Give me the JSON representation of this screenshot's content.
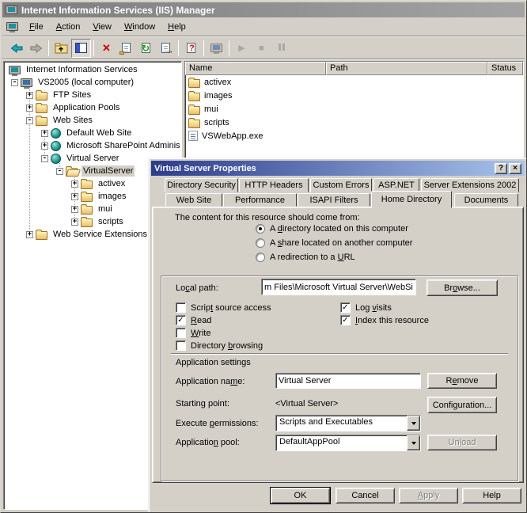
{
  "colors": {
    "face": "#d4d0c8",
    "titlebar_inactive_from": "#7d7d7d",
    "titlebar_inactive_to": "#a3a3a3",
    "dialog_titlebar_from": "#2c3c8c",
    "dialog_titlebar_to": "#a8c4ec",
    "delete_red": "#c40000",
    "selection_inactive": "#d4d0c8"
  },
  "window": {
    "title": "Internet Information Services (IIS) Manager"
  },
  "menu": {
    "items": [
      {
        "key": "F",
        "post": "ile"
      },
      {
        "key": "A",
        "post": "ction"
      },
      {
        "key": "V",
        "post": "iew"
      },
      {
        "key": "W",
        "post": "indow"
      },
      {
        "key": "H",
        "post": "elp"
      }
    ]
  },
  "toolbar": {
    "glyphs": {
      "delete": "✕",
      "refresh": "↻",
      "export_arrow": "→",
      "help": "?",
      "play": "▶",
      "stop": "■"
    }
  },
  "tree": {
    "items": [
      {
        "label": "Internet Information Services",
        "exp": "",
        "icon": "iis-server"
      },
      {
        "label": "VS2005 (local computer)",
        "exp": "-",
        "icon": "computer"
      },
      {
        "label": "FTP Sites",
        "exp": "+",
        "icon": "folder"
      },
      {
        "label": "Application Pools",
        "exp": "+",
        "icon": "folder"
      },
      {
        "label": "Web Sites",
        "exp": "-",
        "icon": "folder"
      },
      {
        "label": "Default Web Site",
        "exp": "+",
        "icon": "globe"
      },
      {
        "label": "Microsoft SharePoint Adminis",
        "exp": "+",
        "icon": "globe"
      },
      {
        "label": "Virtual Server",
        "exp": "-",
        "icon": "globe"
      },
      {
        "label": "VirtualServer",
        "exp": "-",
        "icon": "folder-open",
        "selected": true
      },
      {
        "label": "activex",
        "exp": "+",
        "icon": "folder"
      },
      {
        "label": "images",
        "exp": "+",
        "icon": "folder"
      },
      {
        "label": "mui",
        "exp": "+",
        "icon": "folder"
      },
      {
        "label": "scripts",
        "exp": "+",
        "icon": "folder"
      },
      {
        "label": "Web Service Extensions",
        "exp": "+",
        "icon": "folder"
      }
    ]
  },
  "list": {
    "columns": [
      "Name",
      "Path",
      "Status"
    ],
    "rows": [
      {
        "name": "activex",
        "icon": "folder"
      },
      {
        "name": "images",
        "icon": "folder"
      },
      {
        "name": "mui",
        "icon": "folder"
      },
      {
        "name": "scripts",
        "icon": "folder"
      },
      {
        "name": "VSWebApp.exe",
        "icon": "application"
      }
    ]
  },
  "dialog": {
    "title": "Virtual Server Properties",
    "titlebar_buttons": {
      "help": "?",
      "close": "×"
    },
    "tabs_row1": [
      "Directory Security",
      "HTTP Headers",
      "Custom Errors",
      "ASP.NET",
      "Server Extensions 2002"
    ],
    "tabs_row2": [
      "Web Site",
      "Performance",
      "ISAPI Filters",
      "Home Directory",
      "Documents"
    ],
    "active_tab": "Home Directory",
    "content": {
      "intro": "The content for this resource should come from:",
      "radios": [
        {
          "pre": "A ",
          "key": "d",
          "post": "irectory located on this computer",
          "checked": true
        },
        {
          "pre": "A ",
          "key": "s",
          "post": "hare located on another computer",
          "checked": false
        },
        {
          "pre": "A redirection to a ",
          "key": "U",
          "post": "RL",
          "checked": false
        }
      ],
      "local_path": {
        "label": {
          "pre": "Lo",
          "key": "c",
          "post": "al path:"
        },
        "value": "m Files\\Microsoft Virtual Server\\WebSite"
      },
      "browse": {
        "pre": "Br",
        "key": "o",
        "post": "wse..."
      },
      "check_glyph": "✓",
      "checks_left": [
        {
          "pre": "Scrip",
          "key": "t",
          "post": " source access",
          "checked": false
        },
        {
          "pre": "",
          "key": "R",
          "post": "ead",
          "checked": true
        },
        {
          "pre": "",
          "key": "W",
          "post": "rite",
          "checked": false
        },
        {
          "pre": "Directory ",
          "key": "b",
          "post": "rowsing",
          "checked": false
        }
      ],
      "checks_right": [
        {
          "pre": "Log ",
          "key": "v",
          "post": "isits",
          "checked": true
        },
        {
          "pre": "",
          "key": "I",
          "post": "ndex this resource",
          "checked": true
        }
      ],
      "app_settings": "Application settings",
      "app_name": {
        "label": {
          "pre": "Application na",
          "key": "m",
          "post": "e:"
        },
        "value": "Virtual Server"
      },
      "remove": {
        "pre": "R",
        "key": "e",
        "post": "move"
      },
      "starting_point": {
        "label": "Starting point:",
        "value": "<Virtual Server>"
      },
      "configuration": {
        "pre": "Confi",
        "key": "g",
        "post": "uration..."
      },
      "exec_perm": {
        "label": {
          "pre": "Execute ",
          "key": "p",
          "post": "ermissions:"
        },
        "value": "Scripts and Executables"
      },
      "app_pool": {
        "label": {
          "pre": "Applicatio",
          "key": "n",
          "post": " pool:"
        },
        "value": "DefaultAppPool"
      },
      "unload": {
        "pre": "Un",
        "key": "l",
        "post": "oad"
      }
    },
    "buttons": {
      "ok": "OK",
      "cancel": "Cancel",
      "apply": {
        "pre": "",
        "key": "A",
        "post": "pply"
      },
      "help": "Help"
    }
  }
}
